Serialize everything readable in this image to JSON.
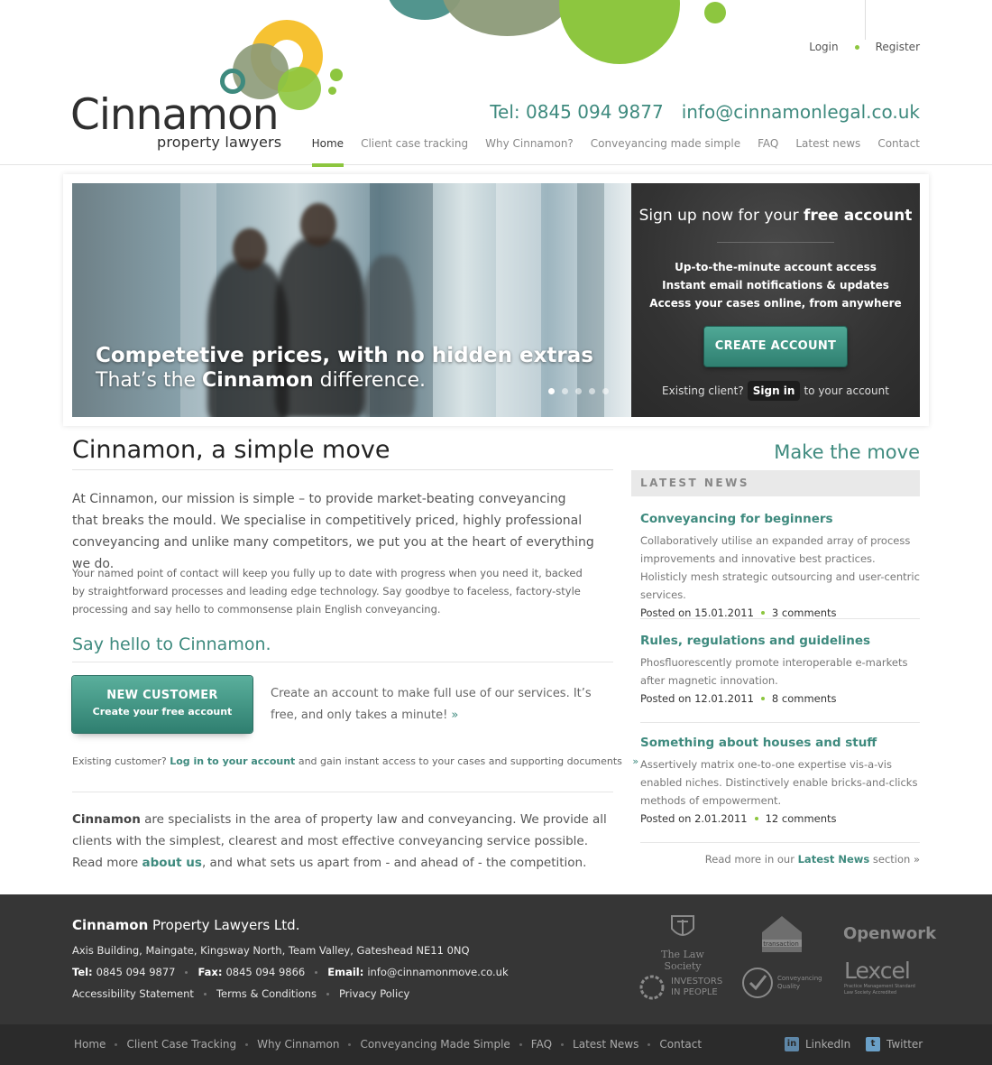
{
  "brand": {
    "logo_name": "Cinnamon",
    "logo_sub": "property lawyers",
    "green": "#8dc63f",
    "teal": "#3e8a7e",
    "olive": "#8c9a78",
    "yellow": "#f6c232"
  },
  "header": {
    "login": "Login",
    "register": "Register",
    "tel": "Tel: 0845 094 9877",
    "email": "info@cinnamonlegal.co.uk",
    "nav": [
      "Home",
      "Client case tracking",
      "Why Cinnamon?",
      "Conveyancing made simple",
      "FAQ",
      "Latest news",
      "Contact"
    ]
  },
  "hero": {
    "caption_line1": "Competetive prices, with no hidden extras",
    "caption_line2_pre": "That’s the ",
    "caption_line2_bold": "Cinnamon",
    "caption_line2_post": " difference.",
    "slides": 5,
    "active_slide": 1
  },
  "signup": {
    "title_pre": "Sign up now for your ",
    "title_bold": "free account",
    "benefits": [
      "Up-to-the-minute account access",
      "Instant email notifications & updates",
      "Access your cases online, from anywhere"
    ],
    "create_button": "CREATE ACCOUNT",
    "existing_pre": "Existing client?",
    "sign_in": "Sign in",
    "existing_post": "to your account"
  },
  "main": {
    "title": "Cinnamon, a simple move",
    "make_move": "Make the move",
    "lead": "At Cinnamon, our mission is simple – to provide market-beating conveyancing that breaks the mould. We specialise in competitively priced, highly professional conveyancing and unlike many competitors, we put you at the heart of everything we do.",
    "small": "Your named point of contact will keep you fully up to date with progress when you need it, backed by straightforward processes and leading edge technology. Say goodbye to faceless, factory-style processing and say hello to commonsense plain English conveyancing.",
    "say_hello": "Say hello to Cinnamon.",
    "new_customer_line1": "NEW CUSTOMER",
    "new_customer_line2": "Create your free account",
    "new_customer_text": "Create an account to make full use of our services. It’s free, and only takes a minute!",
    "raquo": "»",
    "existing_pre": "Existing customer?",
    "existing_link": "Log in to your account",
    "existing_post": "and gain instant access to your cases and supporting documents",
    "about_bold": "Cinnamon",
    "about_rest": " are specialists in the area of property law and conveyancing. We provide all clients with the simplest, clearest and most effective conveyancing service possible.",
    "about_read_pre": "Read more ",
    "about_link": "about us",
    "about_read_post": ", and what sets us apart from - and ahead of - the competition."
  },
  "news": {
    "heading": "LATEST NEWS",
    "items": [
      {
        "title": "Conveyancing for beginners",
        "desc": "Collaboratively utilise an expanded array of process improvements and innovative best practices. Holisticly mesh strategic outsourcing and user-centric services.",
        "posted": "Posted on 15.01.2011",
        "comments": "3 comments"
      },
      {
        "title": "Rules, regulations and guidelines",
        "desc": "Phosfluorescently promote interoperable e-markets after magnetic innovation.",
        "posted": "Posted on 12.01.2011",
        "comments": "8 comments"
      },
      {
        "title": "Something about houses and stuff",
        "desc": "Assertively matrix one-to-one expertise vis-a-vis enabled niches. Distinctively enable bricks-and-clicks methods of empowerment.",
        "posted": "Posted on 2.01.2011",
        "comments": "12 comments"
      }
    ],
    "read_more_pre": "Read more in our",
    "read_more_link": "Latest News",
    "read_more_post": "section »"
  },
  "footer": {
    "company_bold": "Cinnamon",
    "company_rest": " Property Lawyers Ltd.",
    "address": "Axis Building, Maingate, Kingsway North, Team Valley, Gateshead NE11 0NQ",
    "tel_label": "Tel:",
    "tel": "0845 094 9877",
    "fax_label": "Fax:",
    "fax": "0845 094 9866",
    "email_label": "Email:",
    "email": "info@cinnamonmove.co.uk",
    "links": [
      "Accessibility Statement",
      "Terms & Conditions",
      "Privacy Policy"
    ],
    "badges": {
      "law_society": "The Law Society",
      "transaction": "transaction",
      "openwork": "Openwork",
      "investors_1": "INVESTORS",
      "investors_2": "IN PEOPLE",
      "cq_1": "Conveyancing",
      "cq_2": "Quality",
      "lexcel": "Lexcel",
      "lexcel_sub1": "Practice Management Standard",
      "lexcel_sub2": "Law Society Accredited"
    }
  },
  "bottom": {
    "nav": [
      "Home",
      "Client Case Tracking",
      "Why Cinnamon",
      "Conveyancing Made Simple",
      "FAQ",
      "Latest News",
      "Contact"
    ],
    "linkedin": "LinkedIn",
    "twitter": "Twitter",
    "linkedin_glyph": "in",
    "twitter_glyph": "t"
  }
}
